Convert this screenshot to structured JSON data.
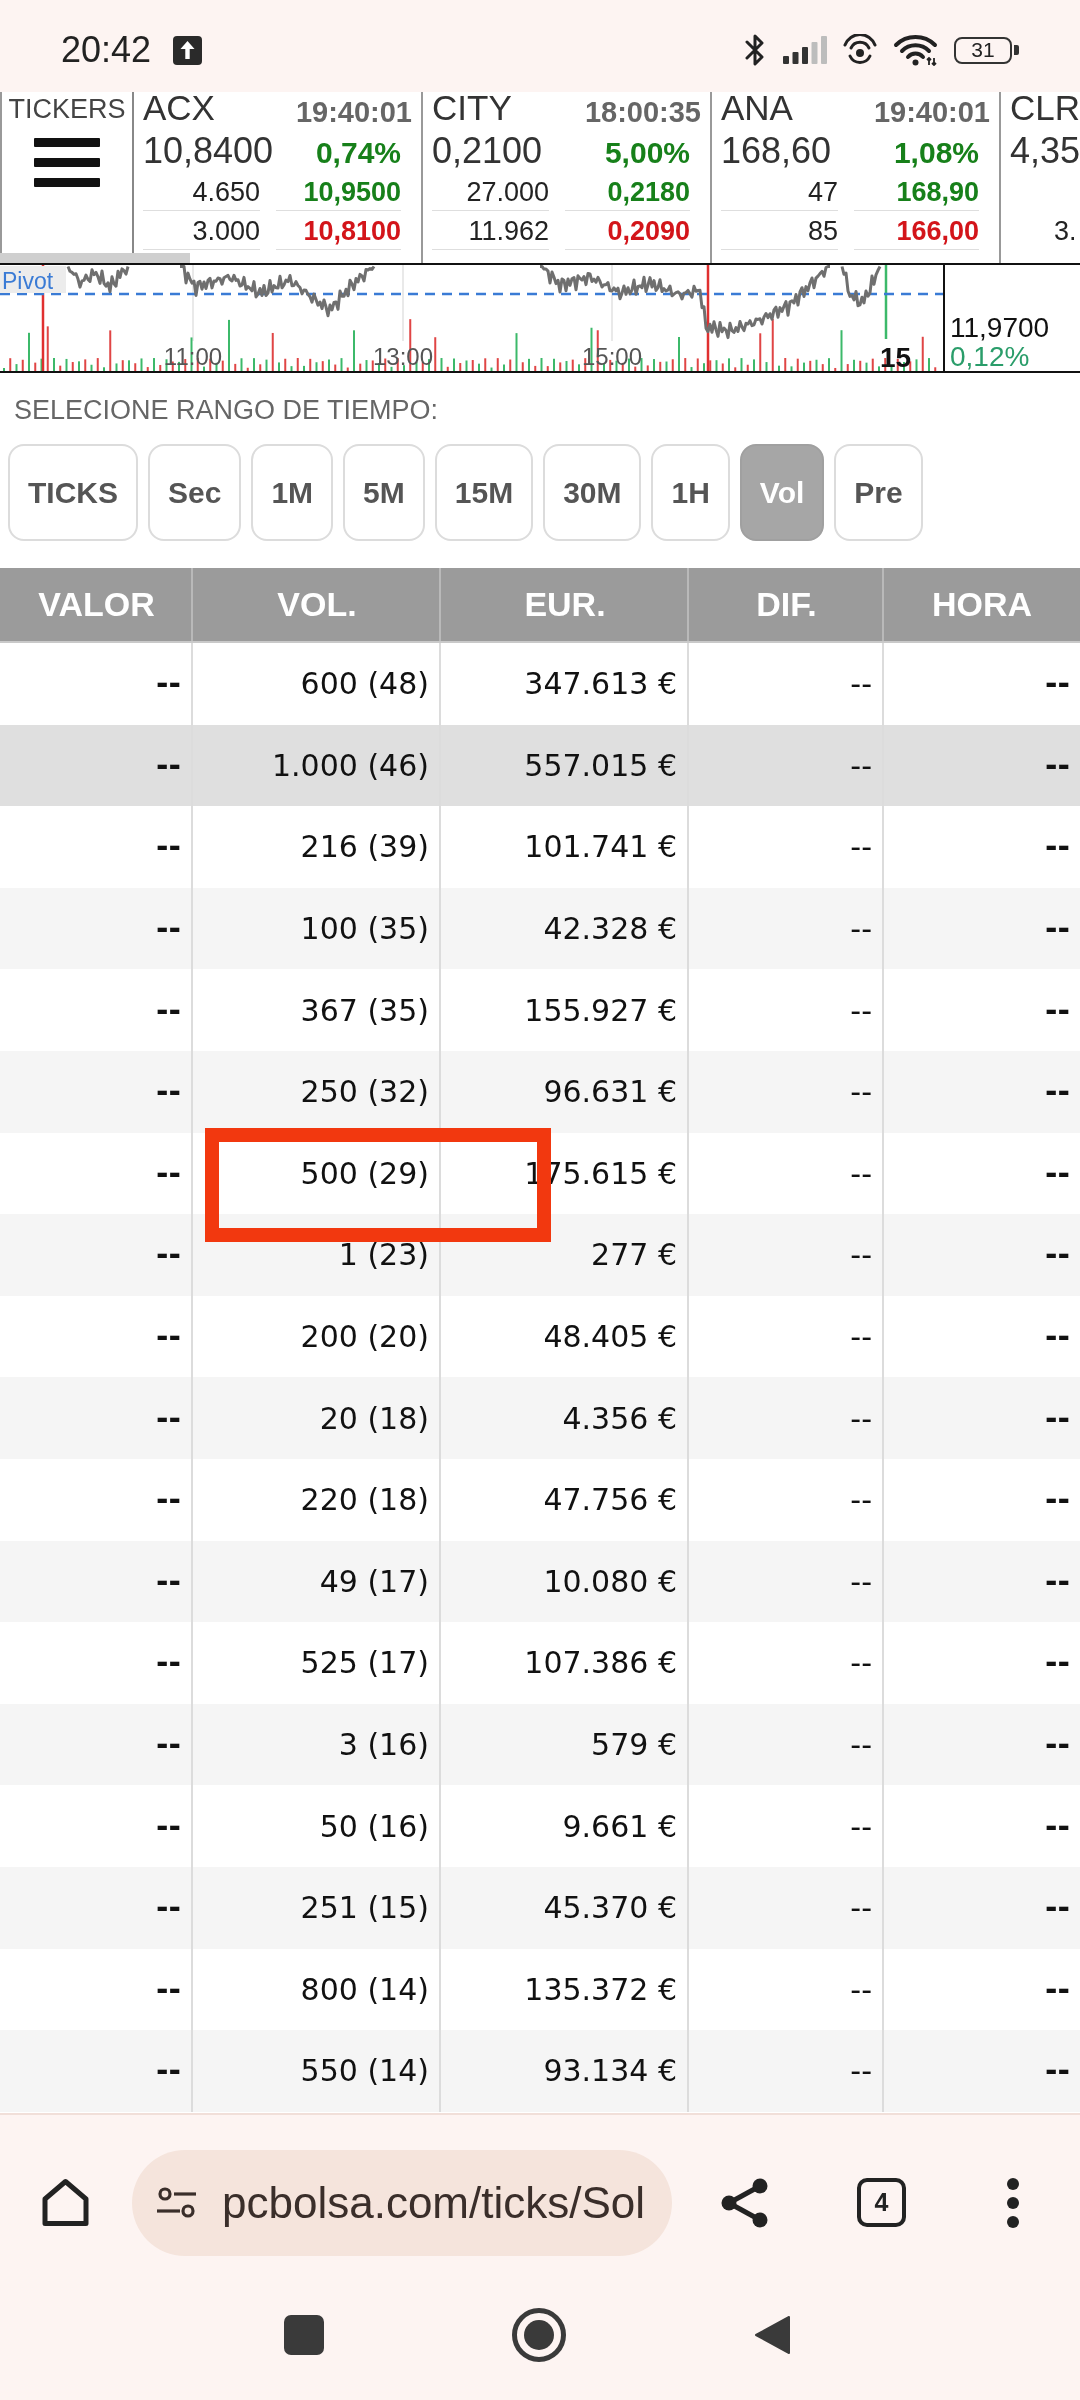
{
  "status_bar": {
    "time": "20:42",
    "battery": "31"
  },
  "tickers_menu": {
    "label": "TICKERS"
  },
  "tickers": [
    {
      "kind": "full",
      "symbol": "ACX",
      "time": "19:40:01",
      "price": "10,8400",
      "change": "0,74%",
      "upper_quantity": "4.650",
      "high": "10,9500",
      "lower_quantity": "3.000",
      "low": "10,8100"
    },
    {
      "kind": "full",
      "symbol": "CITY",
      "time": "18:00:35",
      "price": "0,2100",
      "change": "5,00%",
      "upper_quantity": "27.000",
      "high": "0,2180",
      "lower_quantity": "11.962",
      "low": "0,2090"
    },
    {
      "kind": "full",
      "symbol": "ANA",
      "time": "19:40:01",
      "price": "168,60",
      "change": "1,08%",
      "upper_quantity": "47",
      "high": "168,90",
      "lower_quantity": "85",
      "low": "166,00"
    },
    {
      "kind": "cut",
      "symbol": "CLR",
      "price": "4,35",
      "lower_quantity": "3."
    }
  ],
  "chart": {
    "pivot_label": "Pivot",
    "time_labels": [
      "11:00",
      "13:00",
      "15:00"
    ],
    "corner_label": "15",
    "last_price": "11,9700",
    "last_change": "0,12%"
  },
  "range_selector": {
    "title": "SELECIONE RANGO DE TIEMPO:",
    "buttons": [
      {
        "label": "TICKS",
        "selected": false
      },
      {
        "label": "Sec",
        "selected": false
      },
      {
        "label": "1M",
        "selected": false
      },
      {
        "label": "5M",
        "selected": false
      },
      {
        "label": "15M",
        "selected": false
      },
      {
        "label": "30M",
        "selected": false
      },
      {
        "label": "1H",
        "selected": false
      },
      {
        "label": "Vol",
        "selected": true
      },
      {
        "label": "Pre",
        "selected": false
      }
    ]
  },
  "table": {
    "columns": [
      "VALOR",
      "VOL.",
      "EUR.",
      "DIF.",
      "HORA"
    ],
    "rows": [
      {
        "cells": [
          "--",
          "600 (48)",
          "347.613 €",
          "--",
          "--"
        ],
        "selected": false,
        "annotated": false
      },
      {
        "cells": [
          "--",
          "1.000 (46)",
          "557.015 €",
          "--",
          "--"
        ],
        "selected": true,
        "annotated": false
      },
      {
        "cells": [
          "--",
          "216 (39)",
          "101.741 €",
          "--",
          "--"
        ],
        "selected": false,
        "annotated": false
      },
      {
        "cells": [
          "--",
          "100 (35)",
          "42.328 €",
          "--",
          "--"
        ],
        "selected": false,
        "annotated": false
      },
      {
        "cells": [
          "--",
          "367 (35)",
          "155.927 €",
          "--",
          "--"
        ],
        "selected": false,
        "annotated": false
      },
      {
        "cells": [
          "--",
          "250 (32)",
          "96.631 €",
          "--",
          "--"
        ],
        "selected": false,
        "annotated": false
      },
      {
        "cells": [
          "--",
          "500 (29)",
          "175.615 €",
          "--",
          "--"
        ],
        "selected": false,
        "annotated": true
      },
      {
        "cells": [
          "--",
          "1 (23)",
          "277 €",
          "--",
          "--"
        ],
        "selected": false,
        "annotated": false
      },
      {
        "cells": [
          "--",
          "200 (20)",
          "48.405 €",
          "--",
          "--"
        ],
        "selected": false,
        "annotated": false
      },
      {
        "cells": [
          "--",
          "20 (18)",
          "4.356 €",
          "--",
          "--"
        ],
        "selected": false,
        "annotated": false
      },
      {
        "cells": [
          "--",
          "220 (18)",
          "47.756 €",
          "--",
          "--"
        ],
        "selected": false,
        "annotated": false
      },
      {
        "cells": [
          "--",
          "49 (17)",
          "10.080 €",
          "--",
          "--"
        ],
        "selected": false,
        "annotated": false
      },
      {
        "cells": [
          "--",
          "525 (17)",
          "107.386 €",
          "--",
          "--"
        ],
        "selected": false,
        "annotated": false
      },
      {
        "cells": [
          "--",
          "3 (16)",
          "579 €",
          "--",
          "--"
        ],
        "selected": false,
        "annotated": false
      },
      {
        "cells": [
          "--",
          "50 (16)",
          "9.661 €",
          "--",
          "--"
        ],
        "selected": false,
        "annotated": false
      },
      {
        "cells": [
          "--",
          "251 (15)",
          "45.370 €",
          "--",
          "--"
        ],
        "selected": false,
        "annotated": false
      },
      {
        "cells": [
          "--",
          "800 (14)",
          "135.372 €",
          "--",
          "--"
        ],
        "selected": false,
        "annotated": false
      },
      {
        "cells": [
          "--",
          "550 (14)",
          "93.134 €",
          "--",
          "--"
        ],
        "selected": false,
        "annotated": false
      }
    ]
  },
  "browser_bar": {
    "url": "pcbolsa.com/ticks/Sol",
    "tab_count": "4"
  }
}
